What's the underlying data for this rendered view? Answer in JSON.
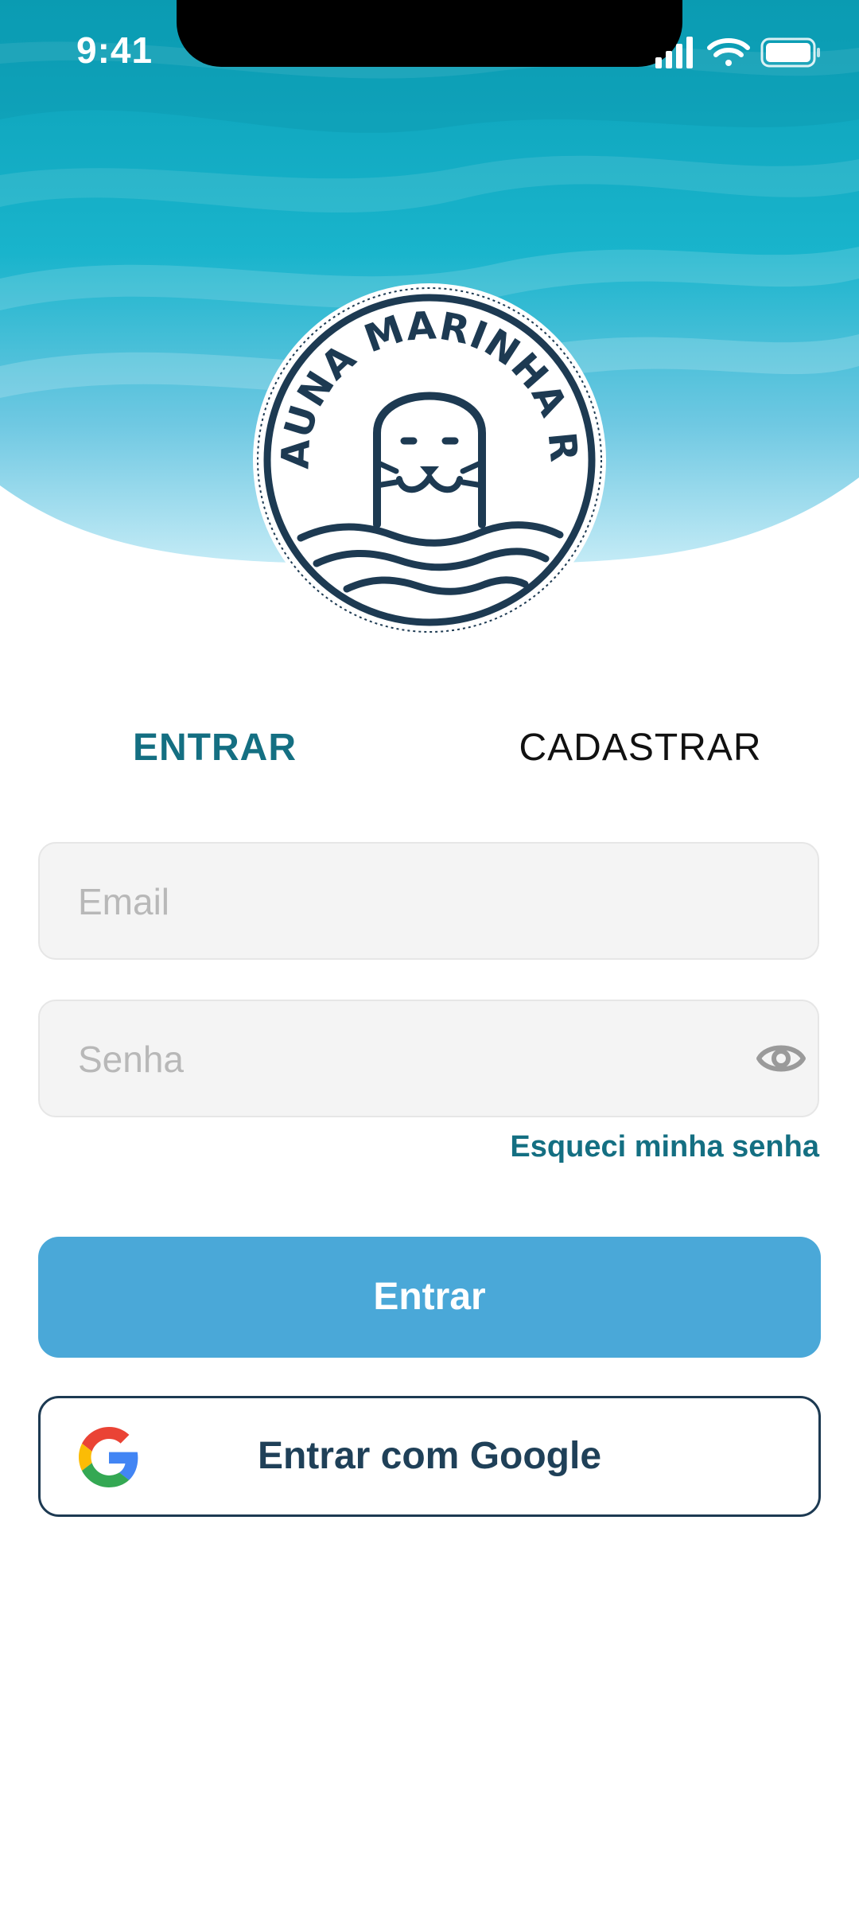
{
  "status_bar": {
    "time": "9:41",
    "icons": [
      "cellular-signal-icon",
      "wifi-icon",
      "battery-icon"
    ]
  },
  "logo": {
    "name": "Fauna Marinha RS",
    "text": "FAUNA MARINHA RS",
    "icon": "seal-logo-icon"
  },
  "tabs": [
    {
      "label": "ENTRAR",
      "active": true
    },
    {
      "label": "CADASTRAR",
      "active": false
    }
  ],
  "form": {
    "email": {
      "placeholder": "Email",
      "value": ""
    },
    "password": {
      "placeholder": "Senha",
      "value": "",
      "toggle_icon": "eye-icon"
    },
    "forgot_password": "Esqueci minha senha",
    "submit_label": "Entrar",
    "google_label": "Entrar com Google",
    "google_icon": "google-icon"
  },
  "colors": {
    "accent": "#146f82",
    "primary_button": "#4aa8d8",
    "google_border": "#1d3a52",
    "header_top": "#0aa3b8",
    "header_bottom": "#a7dcef"
  }
}
